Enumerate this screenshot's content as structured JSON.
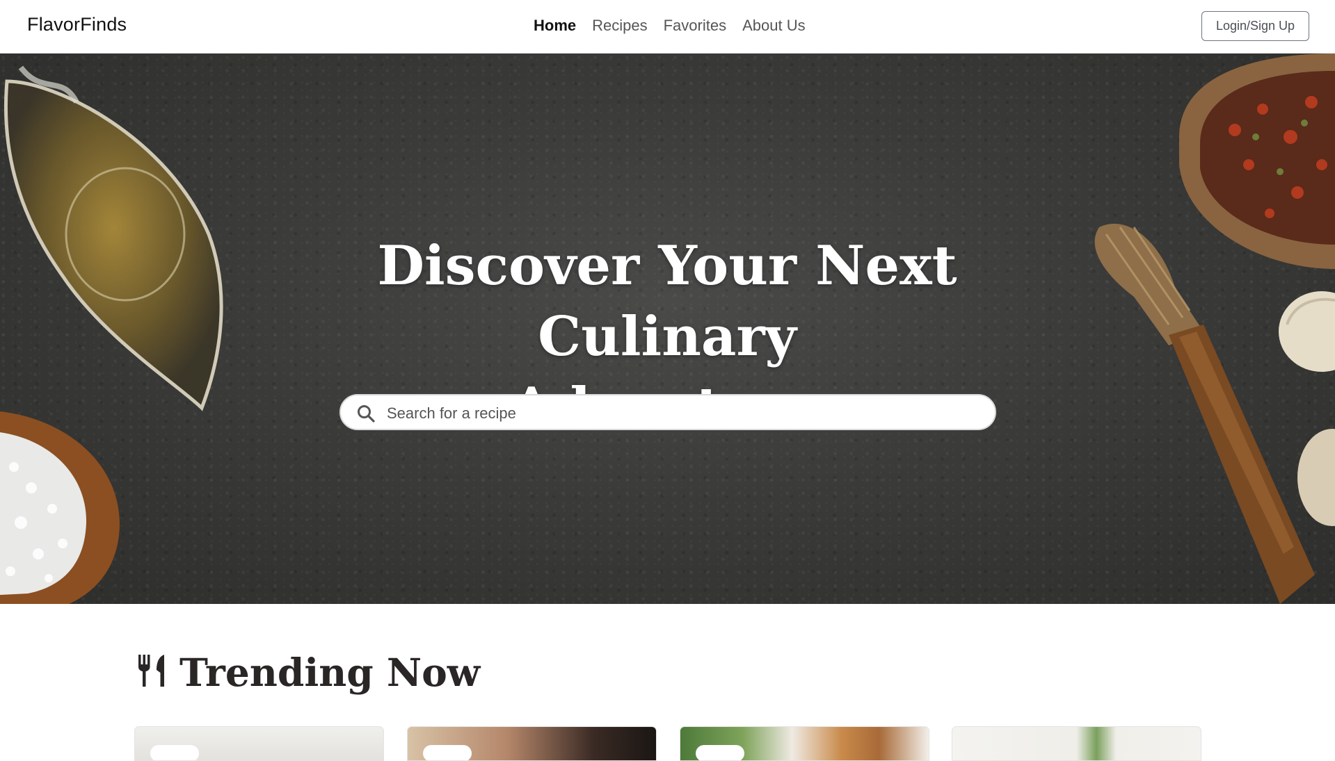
{
  "navbar": {
    "brand": "FlavorFinds",
    "links": [
      {
        "label": "Home",
        "active": true
      },
      {
        "label": "Recipes",
        "active": false
      },
      {
        "label": "Favorites",
        "active": false
      },
      {
        "label": "About Us",
        "active": false
      }
    ],
    "login_label": "Login/Sign Up"
  },
  "hero": {
    "title_line1": "Discover Your Next Culinary",
    "title_line2": "Adventure",
    "search": {
      "placeholder": "Search for a recipe",
      "value": "",
      "icon": "search-icon"
    }
  },
  "trending": {
    "title": "Trending Now",
    "icon": "utensils-icon",
    "cards": [
      {
        "image": "recipe-image-1"
      },
      {
        "image": "recipe-image-2"
      },
      {
        "image": "recipe-image-3"
      },
      {
        "image": "recipe-image-4"
      }
    ]
  },
  "colors": {
    "hero_background": "#3b3b39",
    "heading_text": "#2a2626",
    "nav_active": "#111111",
    "nav_inactive": "#555555"
  }
}
